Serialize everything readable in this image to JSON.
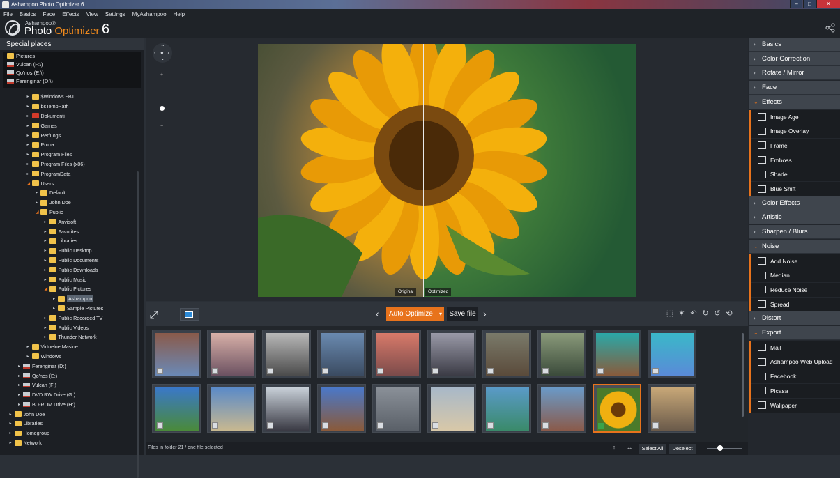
{
  "window": {
    "title": "Ashampoo Photo Optimizer 6",
    "minimize": "–",
    "maximize": "□",
    "close": "✕"
  },
  "menu": [
    "File",
    "Basics",
    "Face",
    "Effects",
    "View",
    "Settings",
    "MyAshampoo",
    "Help"
  ],
  "brand": {
    "small": "Ashampoo®",
    "name_a": "Photo ",
    "name_b": "Optimizer",
    "version": "6"
  },
  "left": {
    "title": "Special places",
    "places": [
      {
        "label": "Pictures",
        "kind": "folder"
      },
      {
        "label": "Vulcan (F:\\)",
        "kind": "drive"
      },
      {
        "label": "Qo'nos (E:\\)",
        "kind": "drive"
      },
      {
        "label": "Ferenginar (D:\\)",
        "kind": "drive"
      }
    ],
    "tree": [
      {
        "label": "$Windows.~BT",
        "lvl": 3,
        "arrow": "▸"
      },
      {
        "label": "bsTempPath",
        "lvl": 3,
        "arrow": "▸"
      },
      {
        "label": "Dokumenti",
        "lvl": 3,
        "arrow": "▸",
        "red": true
      },
      {
        "label": "Games",
        "lvl": 3,
        "arrow": "▸"
      },
      {
        "label": "PerfLogs",
        "lvl": 3,
        "arrow": "▸"
      },
      {
        "label": "Proba",
        "lvl": 3,
        "arrow": "▸"
      },
      {
        "label": "Program Files",
        "lvl": 3,
        "arrow": "▸"
      },
      {
        "label": "Program Files (x86)",
        "lvl": 3,
        "arrow": "▸"
      },
      {
        "label": "ProgramData",
        "lvl": 3,
        "arrow": "▸"
      },
      {
        "label": "Users",
        "lvl": 3,
        "arrow": "◢"
      },
      {
        "label": "Default",
        "lvl": 4,
        "arrow": "▸"
      },
      {
        "label": "John Doe",
        "lvl": 4,
        "arrow": "▸"
      },
      {
        "label": "Public",
        "lvl": 4,
        "arrow": "◢"
      },
      {
        "label": "Anvisoft",
        "lvl": 5,
        "arrow": "▸"
      },
      {
        "label": "Favorites",
        "lvl": 5,
        "arrow": "▸"
      },
      {
        "label": "Libraries",
        "lvl": 5,
        "arrow": "▸"
      },
      {
        "label": "Public Desktop",
        "lvl": 5,
        "arrow": "▸"
      },
      {
        "label": "Public Documents",
        "lvl": 5,
        "arrow": "▸"
      },
      {
        "label": "Public Downloads",
        "lvl": 5,
        "arrow": "▸"
      },
      {
        "label": "Public Music",
        "lvl": 5,
        "arrow": "▸"
      },
      {
        "label": "Public Pictures",
        "lvl": 5,
        "arrow": "◢"
      },
      {
        "label": "Ashampoo",
        "lvl": 6,
        "arrow": "▸",
        "selected": true
      },
      {
        "label": "Sample Pictures",
        "lvl": 6,
        "arrow": "▸"
      },
      {
        "label": "Public Recorded TV",
        "lvl": 5,
        "arrow": "▸"
      },
      {
        "label": "Public Videos",
        "lvl": 5,
        "arrow": "▸"
      },
      {
        "label": "Thunder Network",
        "lvl": 5,
        "arrow": "▸"
      },
      {
        "label": "Virtuelne Masine",
        "lvl": 3,
        "arrow": "▸"
      },
      {
        "label": "Windows",
        "lvl": 3,
        "arrow": "▸"
      },
      {
        "label": "Ferenginar (D:)",
        "lvl": 2,
        "arrow": "▸",
        "drive": true
      },
      {
        "label": "Qo'nos (E:)",
        "lvl": 2,
        "arrow": "▸",
        "drive": true
      },
      {
        "label": "Vulcan (F:)",
        "lvl": 2,
        "arrow": "▸",
        "drive": true
      },
      {
        "label": "DVD RW Drive (G:)",
        "lvl": 2,
        "arrow": "▸",
        "drive": true
      },
      {
        "label": "BD-ROM Drive (H:)",
        "lvl": 2,
        "arrow": "▸",
        "drive": true
      },
      {
        "label": "John Doe",
        "lvl": 1,
        "arrow": "▸"
      },
      {
        "label": "Libraries",
        "lvl": 1,
        "arrow": "▸"
      },
      {
        "label": "Homegroup",
        "lvl": 1,
        "arrow": "▸"
      },
      {
        "label": "Network",
        "lvl": 1,
        "arrow": "▸"
      }
    ]
  },
  "viewer": {
    "tag_original": "Original",
    "tag_optimized": "Optimized",
    "zoom_plus": "+",
    "zoom_minus": "−"
  },
  "toolbar": {
    "auto_label": "Auto Optimize",
    "save_label": "Save file",
    "prev": "‹",
    "next": "›",
    "tools": [
      "⬚",
      "✶",
      "↶",
      "↻",
      "↺",
      "⟲"
    ]
  },
  "thumbnails": [
    {
      "colors": [
        "#8a5a4a",
        "#6a8ab8"
      ]
    },
    {
      "colors": [
        "#d8b0a8",
        "#6a5060"
      ]
    },
    {
      "colors": [
        "#b8b8b8",
        "#4a4a4a"
      ]
    },
    {
      "colors": [
        "#6a8ab0",
        "#3a4a60"
      ]
    },
    {
      "colors": [
        "#d87a6a",
        "#7a4a4a"
      ]
    },
    {
      "colors": [
        "#9a9aa8",
        "#3a3a44"
      ]
    },
    {
      "colors": [
        "#7a7a6a",
        "#5a4a3a"
      ]
    },
    {
      "colors": [
        "#8a9a7a",
        "#3a4a3a"
      ]
    },
    {
      "colors": [
        "#2aa8a8",
        "#8a5a3a"
      ]
    },
    {
      "colors": [
        "#3ab8c8",
        "#5a8ad8"
      ]
    },
    {
      "colors": [
        "#3a78c8",
        "#4a8a3a"
      ]
    },
    {
      "colors": [
        "#5a8ac8",
        "#c8b890"
      ]
    },
    {
      "colors": [
        "#c8d0d8",
        "#3a3a44"
      ]
    },
    {
      "colors": [
        "#4a78c8",
        "#8a5a3a"
      ]
    },
    {
      "colors": [
        "#8a9098",
        "#5a6068"
      ]
    },
    {
      "colors": [
        "#a8b8c8",
        "#d8c8a8"
      ]
    },
    {
      "colors": [
        "#5a9ac8",
        "#3a8a6a"
      ]
    },
    {
      "colors": [
        "#6a9ac8",
        "#8a5a4a"
      ]
    },
    {
      "colors": [
        "#f0b010",
        "#4a7a2a"
      ],
      "selected": true
    },
    {
      "colors": [
        "#c8a878",
        "#6a5a4a"
      ]
    }
  ],
  "status": {
    "text": "Files in folder 21 / one file selected",
    "select_all": "Select All",
    "deselect": "Deselect",
    "up": "↕",
    "lr": "↔"
  },
  "right": {
    "categories": [
      {
        "label": "Basics",
        "open": false
      },
      {
        "label": "Color Correction",
        "open": false
      },
      {
        "label": "Rotate / Mirror",
        "open": false
      },
      {
        "label": "Face",
        "open": false
      },
      {
        "label": "Effects",
        "open": true,
        "items": [
          "Image Age",
          "Image Overlay",
          "Frame",
          "Emboss",
          "Shade",
          "Blue Shift"
        ]
      },
      {
        "label": "Color Effects",
        "open": false
      },
      {
        "label": "Artistic",
        "open": false
      },
      {
        "label": "Sharpen / Blurs",
        "open": false
      },
      {
        "label": "Noise",
        "open": true,
        "items": [
          "Add Noise",
          "Median",
          "Reduce Noise",
          "Spread"
        ]
      },
      {
        "label": "Distort",
        "open": false
      },
      {
        "label": "Export",
        "open": true,
        "items": [
          "Mail",
          "Ashampoo Web Upload",
          "Facebook",
          "Picasa",
          "Wallpaper"
        ]
      }
    ]
  }
}
